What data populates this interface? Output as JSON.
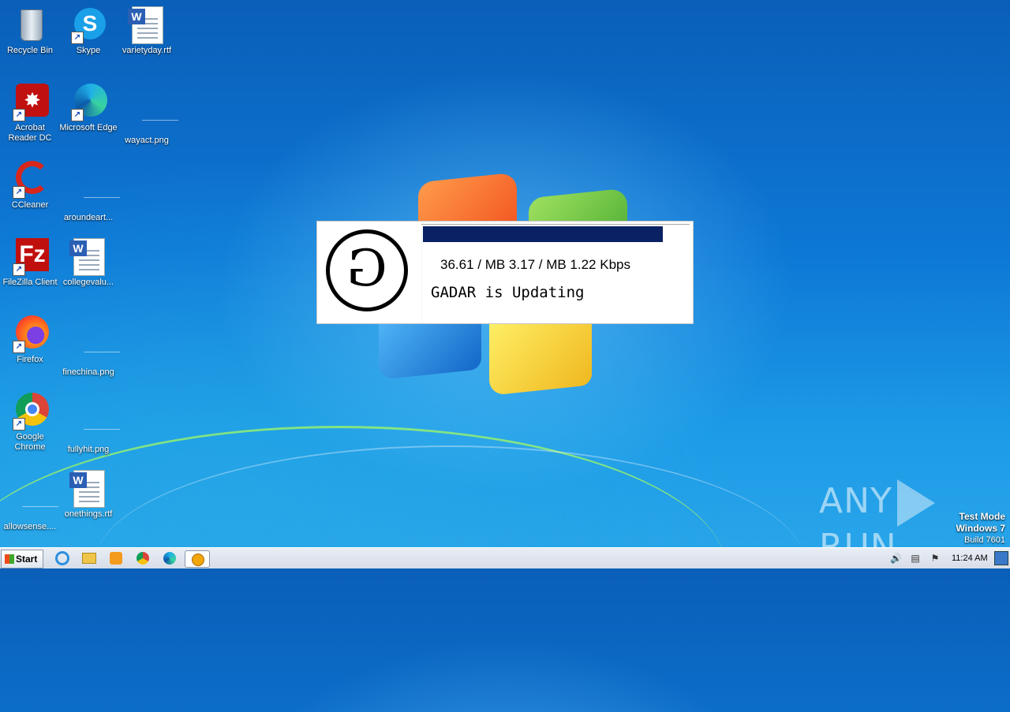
{
  "desktop": {
    "icons": [
      {
        "label": "Recycle Bin"
      },
      {
        "label": "Skype"
      },
      {
        "label": "varietyday.rtf"
      },
      {
        "label": "Acrobat Reader DC"
      },
      {
        "label": "Microsoft Edge"
      },
      {
        "label": "wayact.png"
      },
      {
        "label": "CCleaner"
      },
      {
        "label": "aroundeart..."
      },
      {
        "label": "FileZilla Client"
      },
      {
        "label": "collegevalu..."
      },
      {
        "label": "Firefox"
      },
      {
        "label": "finechina.png"
      },
      {
        "label": "Google Chrome"
      },
      {
        "label": "fullyhit.png"
      },
      {
        "label": "allowsense...."
      },
      {
        "label": "onethings.rtf"
      }
    ]
  },
  "updater": {
    "logo_glyph": "G",
    "progress": 0.9,
    "stats": "36.61 / MB 3.17 / MB 1.22 Kbps",
    "status": "GADAR is Updating"
  },
  "watermark": {
    "left": "ANY",
    "right": "RUN"
  },
  "os_notice": {
    "line1": "Test Mode",
    "line2": "Windows 7",
    "line3": "Build 7601"
  },
  "taskbar": {
    "start_label": "Start",
    "pinned": [
      "ie-icon",
      "explorer-icon",
      "media-player-icon",
      "chrome-icon",
      "edge-icon",
      "gadar-app-icon"
    ],
    "clock": "11:24 AM"
  },
  "colors": {
    "progress_fill": "#0a2163",
    "desktop_blue": "#0d78d6"
  }
}
